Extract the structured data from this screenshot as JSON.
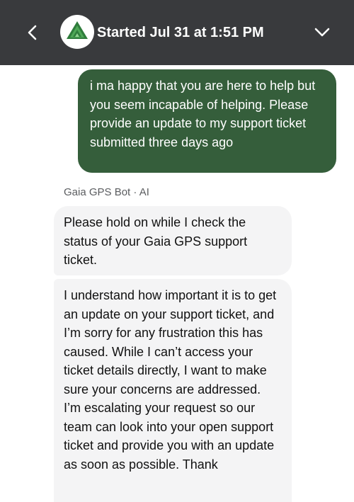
{
  "header": {
    "title": "Started Jul 31 at 1:51 PM",
    "background": "#393a3d",
    "back_icon": "chevron-left-icon",
    "collapse_icon": "chevron-down-icon",
    "logo_icon": "gaia-gps-logo-icon"
  },
  "messages": {
    "user_message": "i ma happy that you are here to help but you seem incapable of helping. Please provide an update to my support ticket submitted three days ago",
    "bot_sender": "Gaia GPS Bot · AI",
    "bot_message_1": "Please hold on while I check the status of your Gaia GPS support ticket.",
    "bot_message_2": "I understand how important it is to get an update on your support ticket, and I’m sorry for any frustration this has caused. While I can’t access your ticket details directly, I want to make sure your concerns are addressed. I’m escalating your request so our team can look into your open support ticket and provide you with an update as soon as possible. Thank"
  },
  "colors": {
    "user_bubble": "#355e3b",
    "bot_bubble": "#f4f4f5",
    "header_bg": "#393a3d"
  }
}
